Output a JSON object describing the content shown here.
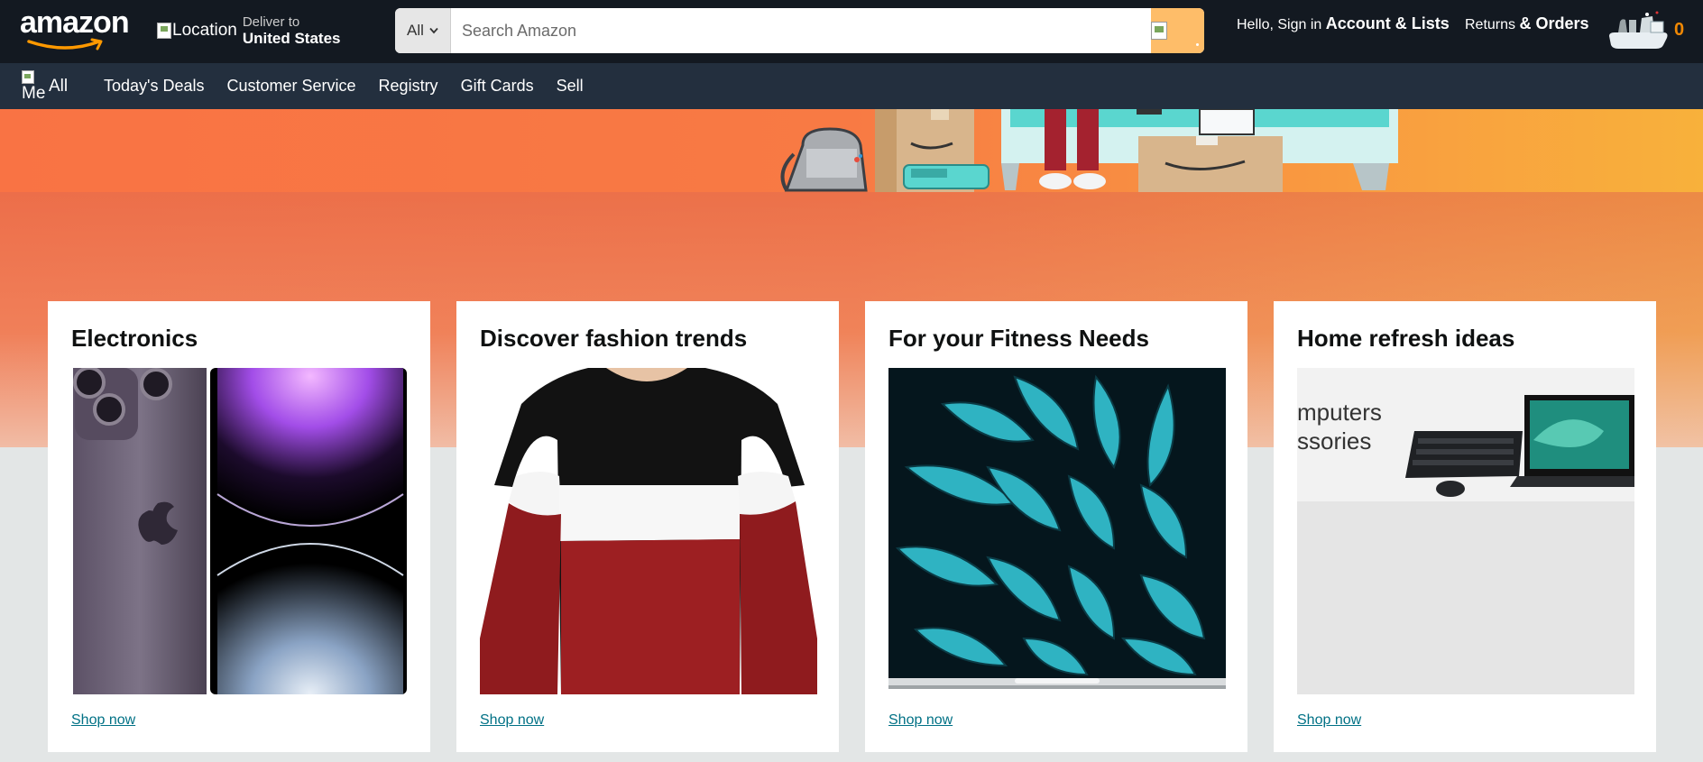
{
  "header": {
    "logo_text": "amazon",
    "location_alt": "Location",
    "deliver_line1": "Deliver to",
    "deliver_line2": "United States",
    "search_category": "All",
    "search_placeholder": "Search Amazon",
    "account_small": "Hello, Sign in",
    "account_big": "Account & Lists",
    "returns_small": "Returns",
    "returns_big": "& Orders",
    "cart_count": "0"
  },
  "subnav": {
    "menu_alt": "Me",
    "all_label": "All",
    "links": [
      "Today's Deals",
      "Customer Service",
      "Registry",
      "Gift Cards",
      "Sell"
    ]
  },
  "cards": [
    {
      "title": "Electronics",
      "link": "Shop now"
    },
    {
      "title": "Discover fashion trends",
      "link": "Shop now"
    },
    {
      "title": "For your Fitness Needs",
      "link": "Shop now"
    },
    {
      "title": "Home refresh ideas",
      "link": "Shop now",
      "image_text_1": "mputers",
      "image_text_2": "ssories"
    }
  ],
  "colors": {
    "nav_bg": "#131921",
    "subnav_bg": "#232f3e",
    "search_button": "#febd69",
    "cart_count": "#f08804",
    "link": "#007185"
  },
  "icons": {
    "search": "search-icon",
    "cart": "cart-icon",
    "dropdown": "chevron-down-icon",
    "menu": "menu-icon"
  }
}
